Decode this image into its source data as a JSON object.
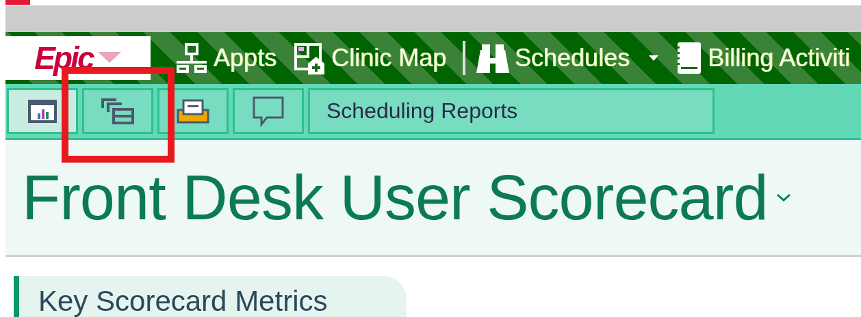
{
  "logo": {
    "text": "Epic"
  },
  "toolbar": [
    {
      "kind": "appts",
      "label": "Appts",
      "dropdown": false
    },
    {
      "kind": "map",
      "label": "Clinic Map",
      "dropdown": false
    },
    {
      "kind": "separator"
    },
    {
      "kind": "binoculars",
      "label": "Schedules",
      "dropdown": true
    },
    {
      "kind": "notebook",
      "label": "Billing Activiti",
      "dropdown": false
    }
  ],
  "tabs": [
    {
      "kind": "chart",
      "selected": true
    },
    {
      "kind": "windows",
      "selected": false
    },
    {
      "kind": "inbox",
      "selected": false
    },
    {
      "kind": "chat",
      "selected": false
    },
    {
      "kind": "text",
      "label": "Scheduling Reports",
      "selected": false
    }
  ],
  "page": {
    "title": "Front Desk User Scorecard"
  },
  "section": {
    "title": "Key Scorecard Metrics"
  }
}
